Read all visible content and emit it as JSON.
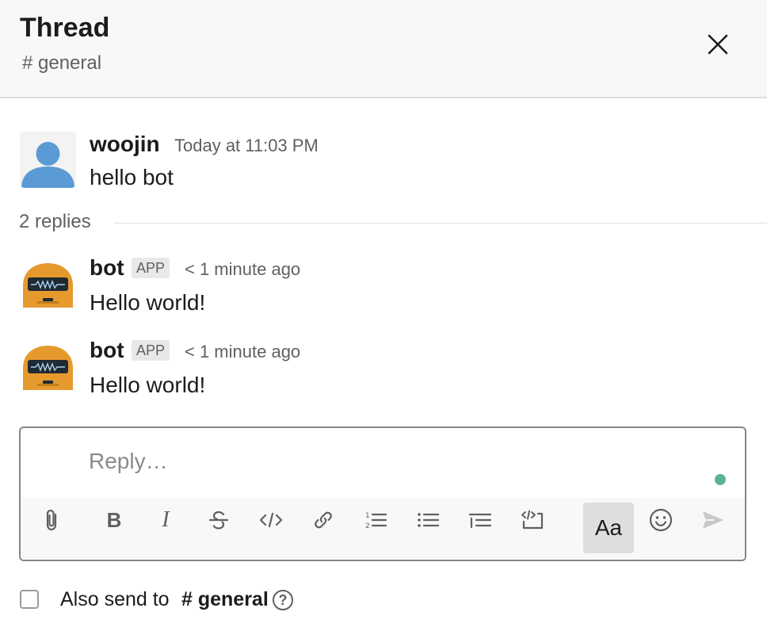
{
  "header": {
    "title": "Thread",
    "channel": "# general"
  },
  "parent_message": {
    "author": "woojin",
    "timestamp": "Today at 11:03 PM",
    "text": "hello bot"
  },
  "replies": {
    "count_label": "2 replies",
    "items": [
      {
        "author": "bot",
        "badge": "APP",
        "timestamp": "< 1 minute ago",
        "text": "Hello world!"
      },
      {
        "author": "bot",
        "badge": "APP",
        "timestamp": "< 1 minute ago",
        "text": "Hello world!"
      }
    ]
  },
  "composer": {
    "placeholder": "Reply…",
    "format_label": "Aa",
    "toolbar_icons": [
      "attachment-icon",
      "bold-icon",
      "italic-icon",
      "strikethrough-icon",
      "code-icon",
      "link-icon",
      "numbered-list-icon",
      "bulleted-list-icon",
      "blockquote-icon",
      "code-block-icon",
      "formatting-toggle",
      "emoji-icon",
      "send-icon"
    ]
  },
  "also_send": {
    "label": "Also send to",
    "channel": "# general"
  },
  "colors": {
    "user_avatar": "#5b9bd5",
    "bot_avatar": "#e69a2e",
    "presence": "#5bb58f"
  }
}
